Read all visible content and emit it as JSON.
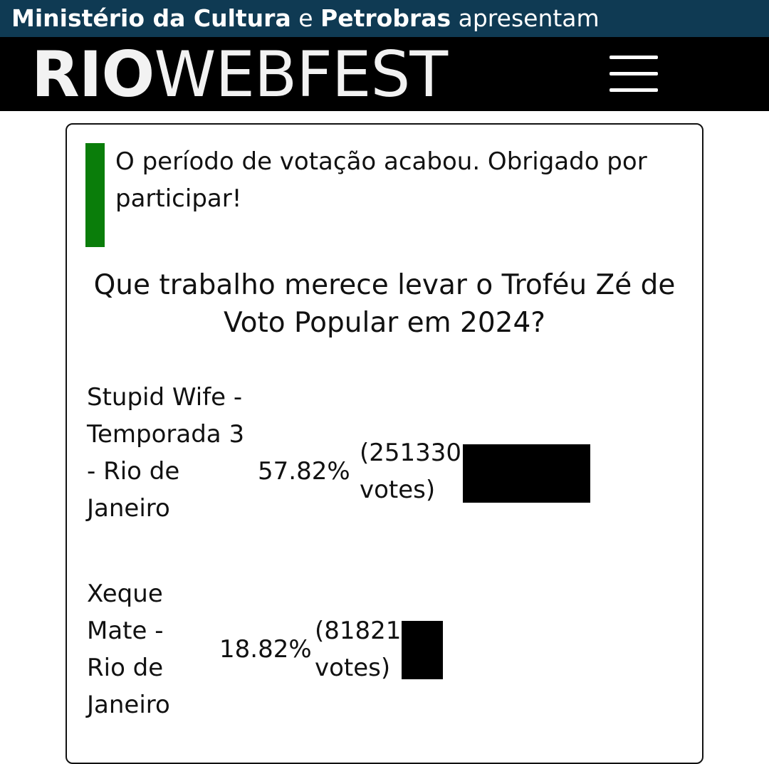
{
  "sponsor": {
    "org1": "Ministério da Cultura",
    "conj": "e",
    "org2": "Petrobras",
    "verb": "apresentam"
  },
  "header": {
    "logo_strong": "RIO",
    "logo_light": "WEBFEST",
    "menu_icon": "hamburger-menu-icon"
  },
  "poll": {
    "notice": "O período de votação acabou. Obrigado por participar!",
    "notice_color": "#0a7d0a",
    "question": "Que trabalho merece levar o Troféu Zé de Voto Popular em 2024?",
    "options": [
      {
        "name": "Stupid Wife - Temporada 3 - Rio de Janeiro",
        "percent": "57.82%",
        "votes": "(251330 votes)",
        "share": 0.5782
      },
      {
        "name": "Xeque Mate - Rio de Janeiro",
        "percent": "18.82%",
        "votes": "(81821 votes)",
        "share": 0.1882
      }
    ]
  }
}
